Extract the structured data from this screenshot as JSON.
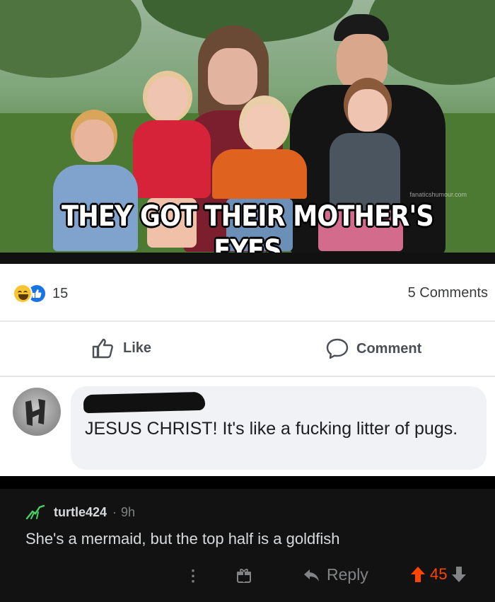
{
  "meme": {
    "caption": "THEY GOT THEIR MOTHER'S EYES",
    "watermark": "fanaticshumour.com"
  },
  "facebook_post": {
    "reactions": {
      "icons": [
        "haha-icon",
        "like-icon"
      ],
      "count": "15"
    },
    "comments_count": "5 Comments",
    "actions": {
      "like_label": "Like",
      "comment_label": "Comment"
    },
    "comment": {
      "author_redacted": true,
      "text": "JESUS CHRIST! It's like a fucking litter of pugs."
    },
    "colors": {
      "like_blue": "#1b74e4",
      "bubble_bg": "#f0f2f5"
    }
  },
  "reddit_comment": {
    "username": "turtle424",
    "age": "9h",
    "separator": "·",
    "body": "She's a mermaid, but the top half is a goldfish",
    "more_label": "⋮",
    "reply_label": "Reply",
    "score": "45",
    "colors": {
      "upvote": "#ff4500",
      "background": "#121212"
    }
  }
}
